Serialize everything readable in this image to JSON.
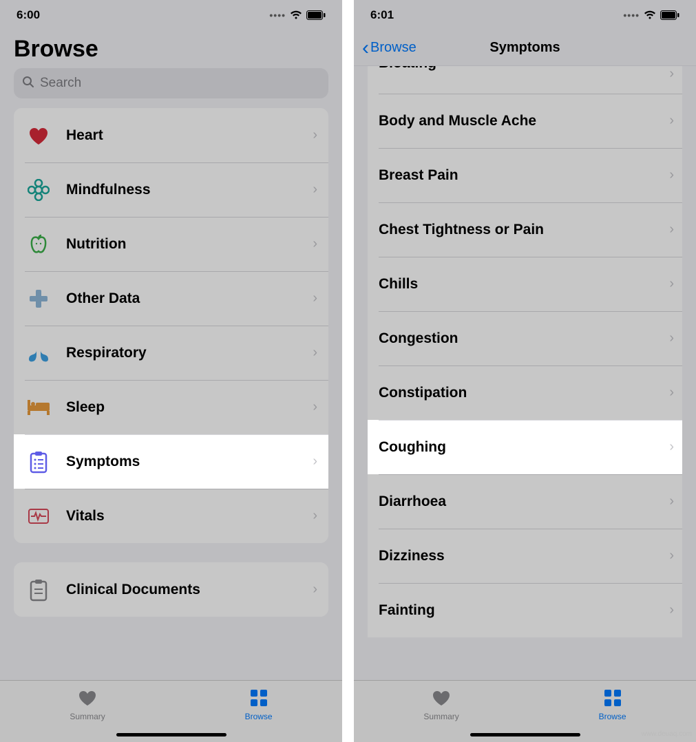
{
  "left": {
    "status": {
      "time": "6:00"
    },
    "title": "Browse",
    "search_placeholder": "Search",
    "categories_group1": [
      {
        "id": "heart",
        "label": "Heart"
      },
      {
        "id": "mindfulness",
        "label": "Mindfulness"
      },
      {
        "id": "nutrition",
        "label": "Nutrition"
      },
      {
        "id": "other-data",
        "label": "Other Data"
      },
      {
        "id": "respiratory",
        "label": "Respiratory"
      },
      {
        "id": "sleep",
        "label": "Sleep"
      },
      {
        "id": "symptoms",
        "label": "Symptoms",
        "highlighted": true
      },
      {
        "id": "vitals",
        "label": "Vitals"
      }
    ],
    "categories_group2": [
      {
        "id": "clinical-documents",
        "label": "Clinical Documents"
      }
    ],
    "tabs": {
      "summary": "Summary",
      "browse": "Browse"
    }
  },
  "right": {
    "status": {
      "time": "6:01"
    },
    "back_label": "Browse",
    "title": "Symptoms",
    "items": [
      {
        "label": "Bloating",
        "partial": true
      },
      {
        "label": "Body and Muscle Ache"
      },
      {
        "label": "Breast Pain"
      },
      {
        "label": "Chest Tightness or Pain"
      },
      {
        "label": "Chills"
      },
      {
        "label": "Congestion"
      },
      {
        "label": "Constipation"
      },
      {
        "label": "Coughing",
        "highlighted": true
      },
      {
        "label": "Diarrhoea"
      },
      {
        "label": "Dizziness"
      },
      {
        "label": "Fainting"
      }
    ],
    "tabs": {
      "summary": "Summary",
      "browse": "Browse"
    }
  },
  "watermark": "www.deuaq.com"
}
